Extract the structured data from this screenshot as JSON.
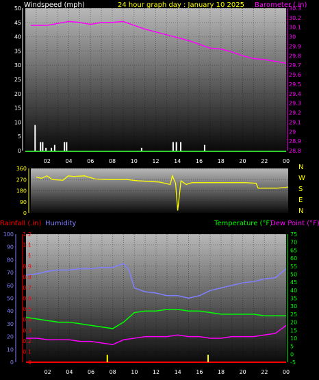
{
  "colors": {
    "background": "#000000",
    "wind": "#ffffff",
    "barometer": "#ff00ff",
    "direction": "#ffff00",
    "rain": "#ff0000",
    "humidity": "#8080ff",
    "temperature": "#00ff00",
    "dewpoint": "#ff00ff"
  },
  "header": {
    "wind_label": "Windspeed (mph)",
    "title": "24 hour graph day : January 10 2025",
    "baro_label": "Barometer (.in)"
  },
  "dir_labels": [
    "N",
    "W",
    "S",
    "E",
    "N"
  ],
  "bottom_labels": {
    "rain": "Rainfall (.in)",
    "humidity": "Humidity",
    "temperature": "Temperature (°F)",
    "dewpoint": "Dew Point (°F)"
  },
  "x_ticks": [
    "02",
    "04",
    "06",
    "08",
    "10",
    "12",
    "14",
    "16",
    "18",
    "20",
    "22",
    "00"
  ],
  "chart_data": [
    {
      "type": "line",
      "title": "24 hour graph day : January 10 2025",
      "x_range_hours": [
        0,
        24
      ],
      "y_left": {
        "label": "Windspeed (mph)",
        "range": [
          0,
          50
        ],
        "ticks": [
          0,
          5,
          10,
          15,
          20,
          25,
          30,
          35,
          40,
          45,
          50
        ]
      },
      "y_right": {
        "label": "Barometer (.in)",
        "range": [
          28.8,
          30.3
        ],
        "ticks": [
          "28.8",
          "28.9",
          "29",
          "29.1",
          "29.2",
          "29.3",
          "29.4",
          "29.5",
          "29.6",
          "29.7",
          "29.8",
          "29.9",
          "30",
          "30.1",
          "30.2",
          "30.3"
        ]
      },
      "series": [
        {
          "name": "Windspeed (mph)",
          "kind": "bar",
          "points": [
            [
              0.9,
              9
            ],
            [
              1.4,
              3
            ],
            [
              1.6,
              3
            ],
            [
              1.9,
              1
            ],
            [
              2.4,
              1
            ],
            [
              2.7,
              2
            ],
            [
              3.6,
              3
            ],
            [
              3.8,
              3
            ],
            [
              10.7,
              1
            ],
            [
              13.6,
              3
            ],
            [
              13.9,
              3
            ],
            [
              14.3,
              3
            ],
            [
              16.5,
              2
            ]
          ]
        },
        {
          "name": "Barometer (.in)",
          "kind": "line",
          "points": [
            [
              0.5,
              30.12
            ],
            [
              2,
              30.12
            ],
            [
              3,
              30.14
            ],
            [
              4,
              30.16
            ],
            [
              5,
              30.15
            ],
            [
              6,
              30.13
            ],
            [
              7,
              30.15
            ],
            [
              8,
              30.15
            ],
            [
              9,
              30.16
            ],
            [
              10,
              30.12
            ],
            [
              11,
              30.08
            ],
            [
              12,
              30.05
            ],
            [
              13,
              30.02
            ],
            [
              14,
              29.99
            ],
            [
              15,
              29.96
            ],
            [
              16,
              29.92
            ],
            [
              17,
              29.88
            ],
            [
              18,
              29.87
            ],
            [
              19,
              29.84
            ],
            [
              20,
              29.8
            ],
            [
              21,
              29.77
            ],
            [
              22,
              29.76
            ],
            [
              23,
              29.74
            ],
            [
              24,
              29.72
            ]
          ]
        }
      ]
    },
    {
      "type": "line",
      "title": "",
      "x_range_hours": [
        0,
        24
      ],
      "y_left": {
        "label": "",
        "range": [
          0,
          360
        ],
        "ticks": [
          0,
          90,
          180,
          270,
          360
        ]
      },
      "series": [
        {
          "name": "Wind direction",
          "points": [
            [
              0.5,
              290
            ],
            [
              1,
              280
            ],
            [
              1.5,
              300
            ],
            [
              2,
              270
            ],
            [
              3,
              265
            ],
            [
              3.5,
              300
            ],
            [
              4,
              295
            ],
            [
              5,
              300
            ],
            [
              6,
              275
            ],
            [
              7,
              270
            ],
            [
              9,
              270
            ],
            [
              10,
              260
            ],
            [
              11,
              255
            ],
            [
              12,
              250
            ],
            [
              12.5,
              240
            ],
            [
              13,
              230
            ],
            [
              13.2,
              300
            ],
            [
              13.5,
              240
            ],
            [
              13.7,
              20
            ],
            [
              14,
              260
            ],
            [
              14.5,
              230
            ],
            [
              15,
              245
            ],
            [
              17,
              245
            ],
            [
              19,
              245
            ],
            [
              20,
              245
            ],
            [
              21,
              240
            ],
            [
              21.2,
              200
            ],
            [
              23,
              200
            ],
            [
              24,
              210
            ]
          ]
        }
      ]
    },
    {
      "type": "line",
      "title": "",
      "x_range_hours": [
        0,
        24
      ],
      "y_rain": {
        "label": "Rainfall (.in)",
        "range": [
          0,
          1.2
        ],
        "ticks": [
          "0",
          "0.1",
          "0.2",
          "0.3",
          "0.4",
          "0.5",
          "0.6",
          "0.7",
          "0.8",
          "0.9",
          "1",
          "1.1",
          "1.2"
        ]
      },
      "y_humidity": {
        "label": "Humidity",
        "range": [
          0,
          100
        ],
        "ticks": [
          0,
          10,
          20,
          30,
          40,
          50,
          60,
          70,
          80,
          90,
          100
        ]
      },
      "y_temp": {
        "label": "Temperature (°F)",
        "range": [
          -5,
          75
        ],
        "ticks": [
          -5,
          0,
          5,
          10,
          15,
          20,
          25,
          30,
          35,
          40,
          45,
          50,
          55,
          60,
          65,
          70,
          75
        ]
      },
      "series": [
        {
          "name": "Rainfall (.in)",
          "kind": "bar",
          "points": [
            [
              7.5,
              0.07
            ],
            [
              16.8,
              0.07
            ]
          ]
        },
        {
          "name": "Humidity",
          "points": [
            [
              0,
              68
            ],
            [
              1,
              69
            ],
            [
              2,
              71
            ],
            [
              3,
              72
            ],
            [
              4,
              72
            ],
            [
              5,
              73
            ],
            [
              6,
              73
            ],
            [
              7,
              74
            ],
            [
              8,
              74
            ],
            [
              9,
              77
            ],
            [
              9.5,
              72
            ],
            [
              10,
              58
            ],
            [
              11,
              55
            ],
            [
              12,
              54
            ],
            [
              13,
              52
            ],
            [
              14,
              52
            ],
            [
              15,
              50
            ],
            [
              16,
              52
            ],
            [
              17,
              56
            ],
            [
              18,
              58
            ],
            [
              19,
              60
            ],
            [
              20,
              62
            ],
            [
              21,
              63
            ],
            [
              22,
              65
            ],
            [
              23,
              66
            ],
            [
              24,
              73
            ]
          ]
        },
        {
          "name": "Temperature (°F)",
          "points": [
            [
              0,
              23
            ],
            [
              1,
              22
            ],
            [
              2,
              21
            ],
            [
              3,
              20
            ],
            [
              4,
              20
            ],
            [
              5,
              19
            ],
            [
              6,
              18
            ],
            [
              7,
              17
            ],
            [
              8,
              16
            ],
            [
              9,
              20
            ],
            [
              10,
              26
            ],
            [
              11,
              27
            ],
            [
              12,
              27
            ],
            [
              13,
              28
            ],
            [
              14,
              28
            ],
            [
              15,
              27
            ],
            [
              16,
              27
            ],
            [
              17,
              26
            ],
            [
              18,
              25
            ],
            [
              19,
              25
            ],
            [
              20,
              25
            ],
            [
              21,
              25
            ],
            [
              22,
              24
            ],
            [
              23,
              24
            ],
            [
              24,
              24
            ]
          ]
        },
        {
          "name": "Dew Point (°F)",
          "points": [
            [
              0,
              10
            ],
            [
              1,
              10
            ],
            [
              2,
              9
            ],
            [
              3,
              9
            ],
            [
              4,
              9
            ],
            [
              5,
              8
            ],
            [
              6,
              8
            ],
            [
              7,
              7
            ],
            [
              8,
              6
            ],
            [
              9,
              9
            ],
            [
              10,
              10
            ],
            [
              11,
              11
            ],
            [
              12,
              11
            ],
            [
              13,
              11
            ],
            [
              14,
              12
            ],
            [
              15,
              11
            ],
            [
              16,
              11
            ],
            [
              17,
              10
            ],
            [
              18,
              10
            ],
            [
              19,
              11
            ],
            [
              20,
              11
            ],
            [
              21,
              11
            ],
            [
              22,
              12
            ],
            [
              23,
              13
            ],
            [
              24,
              18
            ]
          ]
        }
      ]
    }
  ]
}
